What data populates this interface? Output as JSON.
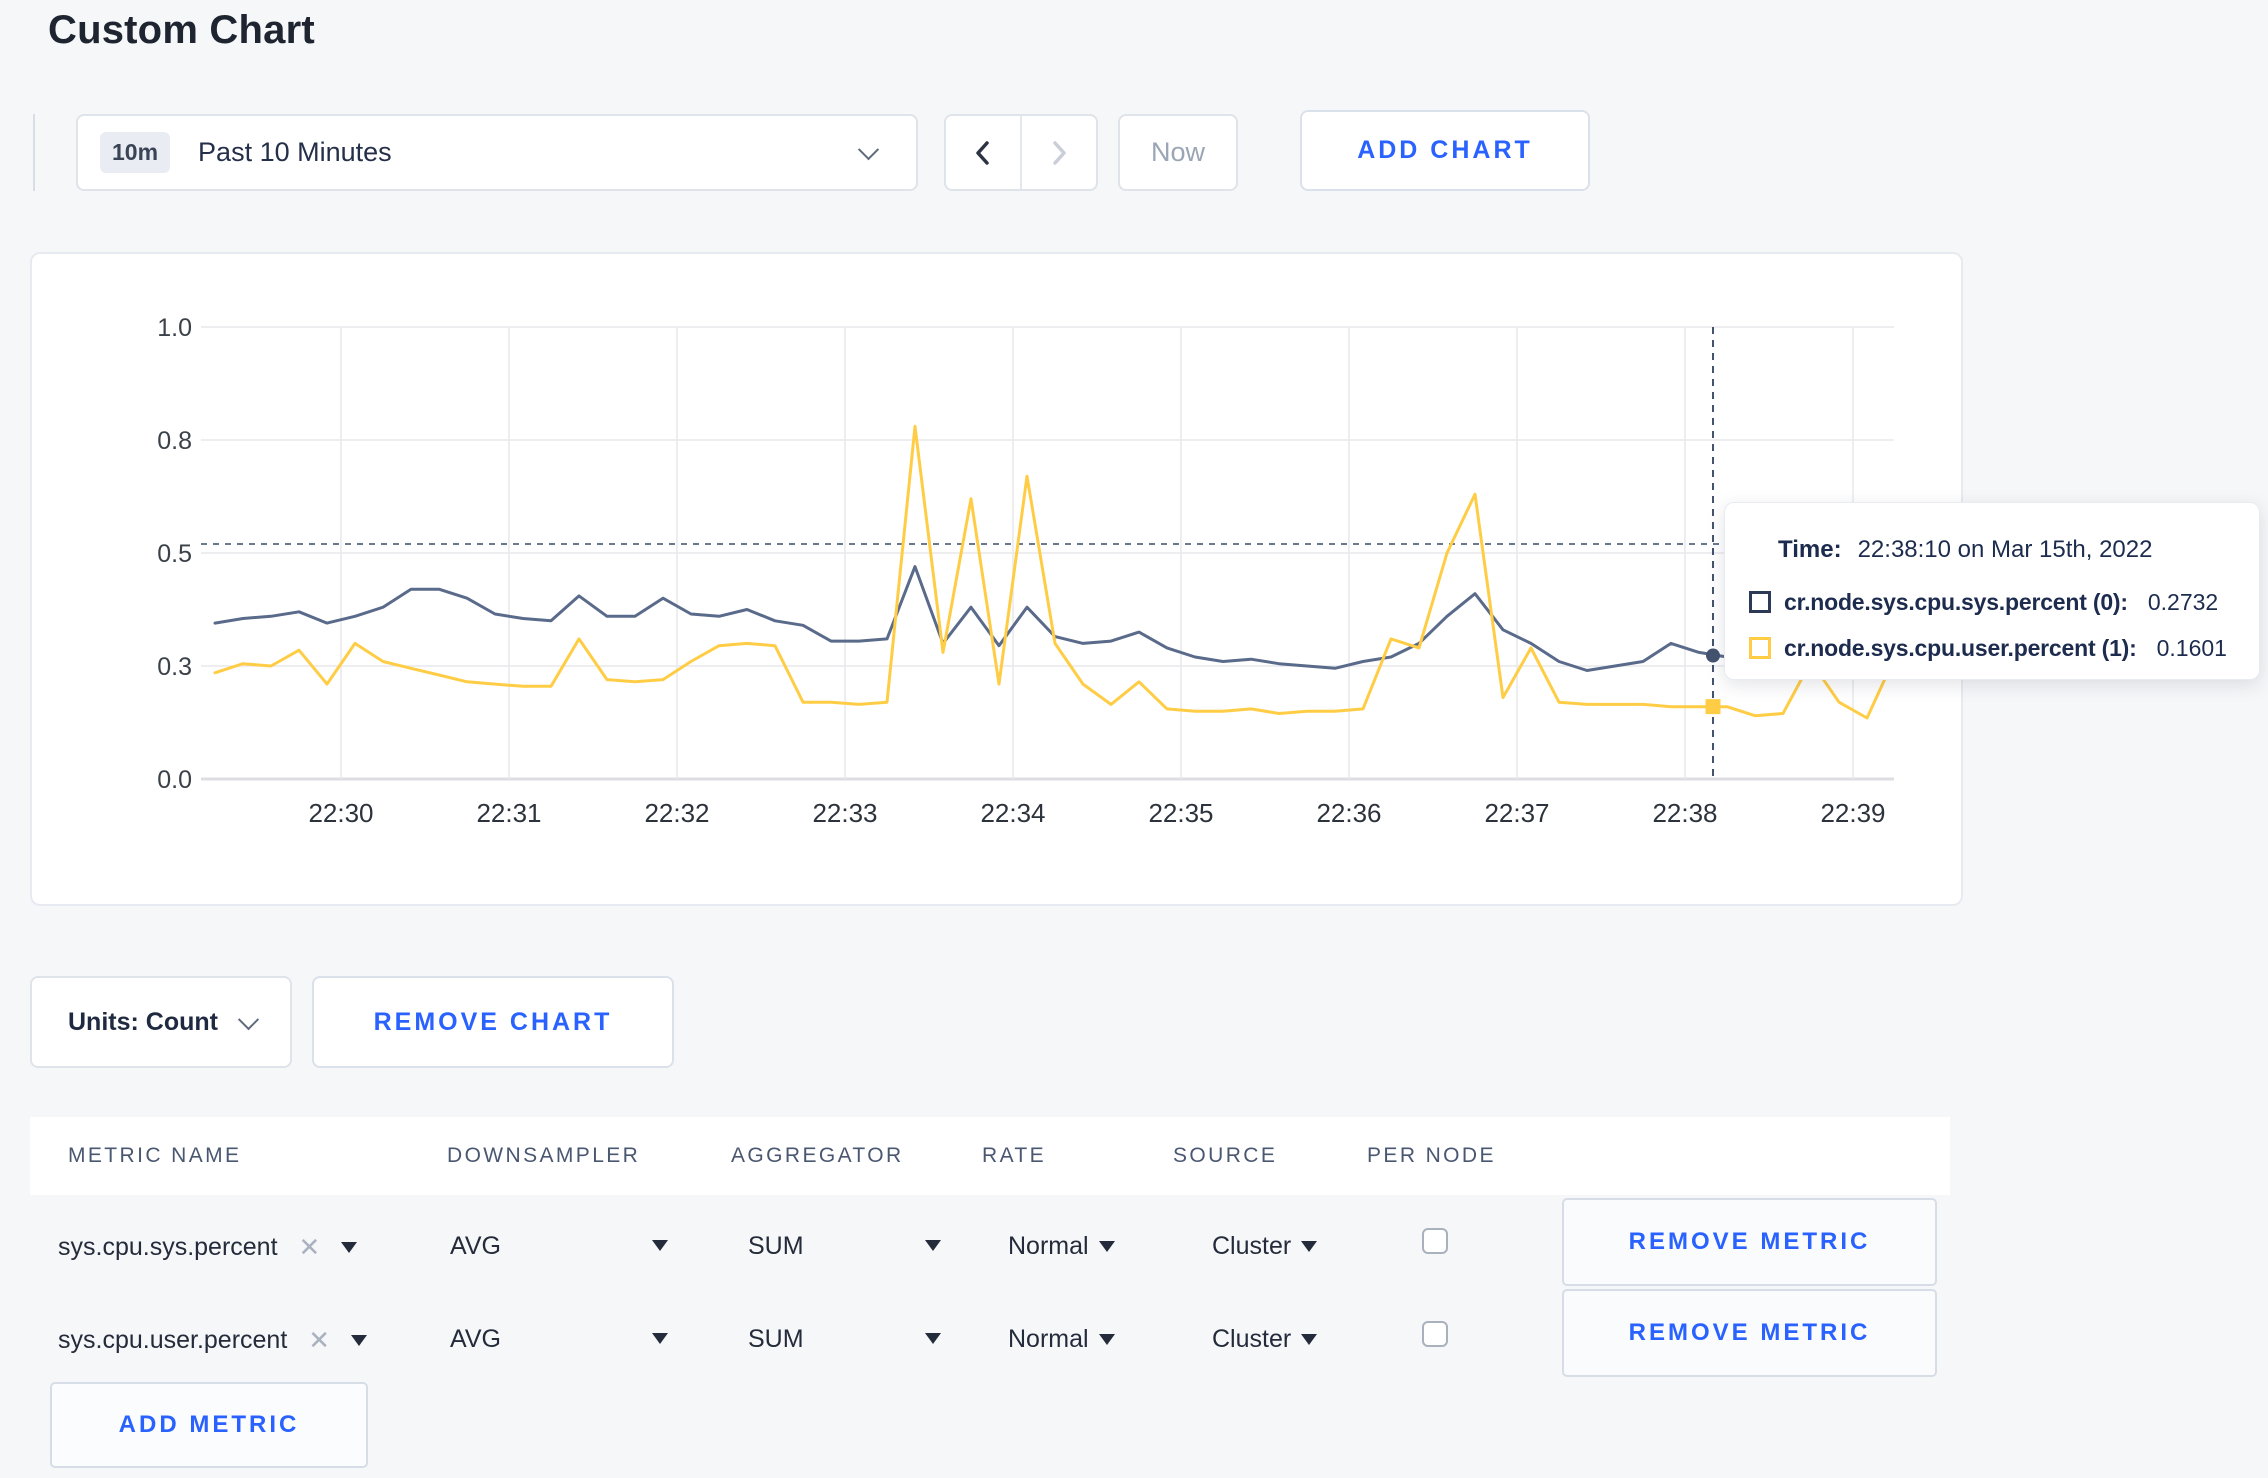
{
  "page": {
    "title": "Custom Chart"
  },
  "toolbar": {
    "time_badge": "10m",
    "time_range": "Past 10 Minutes",
    "now": "Now",
    "add_chart": "ADD CHART"
  },
  "chart_tooltip": {
    "time_label": "Time:",
    "time_value": "22:38:10 on Mar 15th, 2022",
    "series": [
      {
        "name": "cr.node.sys.cpu.sys.percent (0):",
        "value": "0.2732",
        "color": "#2c3a57"
      },
      {
        "name": "cr.node.sys.cpu.user.percent (1):",
        "value": "0.1601",
        "color": "#ffcd45"
      }
    ]
  },
  "units_button": "Units: Count",
  "remove_chart": "REMOVE CHART",
  "metrics_table": {
    "headers": [
      "METRIC NAME",
      "DOWNSAMPLER",
      "AGGREGATOR",
      "RATE",
      "SOURCE",
      "PER NODE"
    ],
    "rows": [
      {
        "name": "sys.cpu.sys.percent",
        "remove_label": "✕",
        "downsampler": "AVG",
        "aggregator": "SUM",
        "rate": "Normal",
        "source": "Cluster",
        "per_node_checked": false
      },
      {
        "name": "sys.cpu.user.percent",
        "remove_label": "✕",
        "downsampler": "AVG",
        "aggregator": "SUM",
        "rate": "Normal",
        "source": "Cluster",
        "per_node_checked": false
      }
    ],
    "remove_metric": "REMOVE METRIC",
    "add_metric": "ADD METRIC"
  },
  "chart_data": {
    "type": "line",
    "title": "",
    "xlabel": "",
    "ylabel": "",
    "ylim": [
      0,
      1
    ],
    "grid": true,
    "x_tick_labels": [
      "22:30",
      "22:31",
      "22:32",
      "22:33",
      "22:34",
      "22:35",
      "22:36",
      "22:37",
      "22:38",
      "22:39"
    ],
    "y_ticks": [
      {
        "value": 0,
        "label": "0.0"
      },
      {
        "value": 0.25,
        "label": "0.3"
      },
      {
        "value": 0.5,
        "label": "0.5"
      },
      {
        "value": 0.75,
        "label": "0.8"
      },
      {
        "value": 1.0,
        "label": "1.0"
      }
    ],
    "x_start": "22:29:15",
    "x_step_seconds": 10,
    "hline_value": 0.52,
    "crosshair": {
      "time": "22:38:10",
      "minutes_after_22_30": 8.1667,
      "sys_value": 0.2732,
      "user_value": 0.1601
    },
    "series": [
      {
        "name": "cr.node.sys.cpu.sys.percent",
        "color": "#5a6a8a",
        "values": [
          0.345,
          0.355,
          0.36,
          0.37,
          0.345,
          0.36,
          0.38,
          0.42,
          0.42,
          0.4,
          0.365,
          0.355,
          0.35,
          0.405,
          0.36,
          0.36,
          0.4,
          0.365,
          0.36,
          0.375,
          0.35,
          0.34,
          0.305,
          0.305,
          0.31,
          0.47,
          0.3,
          0.38,
          0.295,
          0.38,
          0.315,
          0.3,
          0.305,
          0.325,
          0.29,
          0.27,
          0.26,
          0.265,
          0.255,
          0.25,
          0.245,
          0.26,
          0.27,
          0.3,
          0.36,
          0.41,
          0.33,
          0.3,
          0.26,
          0.24,
          0.25,
          0.26,
          0.3,
          0.28,
          0.27,
          0.26,
          0.27,
          0.3,
          0.31,
          0.29,
          0.3
        ]
      },
      {
        "name": "cr.node.sys.cpu.user.percent",
        "color": "#ffcd45",
        "values": [
          0.235,
          0.255,
          0.25,
          0.285,
          0.21,
          0.3,
          0.26,
          0.245,
          0.23,
          0.215,
          0.21,
          0.205,
          0.205,
          0.31,
          0.22,
          0.215,
          0.22,
          0.26,
          0.295,
          0.3,
          0.295,
          0.17,
          0.17,
          0.165,
          0.17,
          0.78,
          0.28,
          0.62,
          0.21,
          0.67,
          0.3,
          0.21,
          0.165,
          0.215,
          0.155,
          0.15,
          0.15,
          0.155,
          0.145,
          0.15,
          0.15,
          0.155,
          0.31,
          0.29,
          0.5,
          0.63,
          0.18,
          0.29,
          0.17,
          0.165,
          0.165,
          0.165,
          0.16,
          0.16,
          0.16,
          0.14,
          0.145,
          0.26,
          0.17,
          0.135,
          0.27
        ]
      }
    ]
  }
}
